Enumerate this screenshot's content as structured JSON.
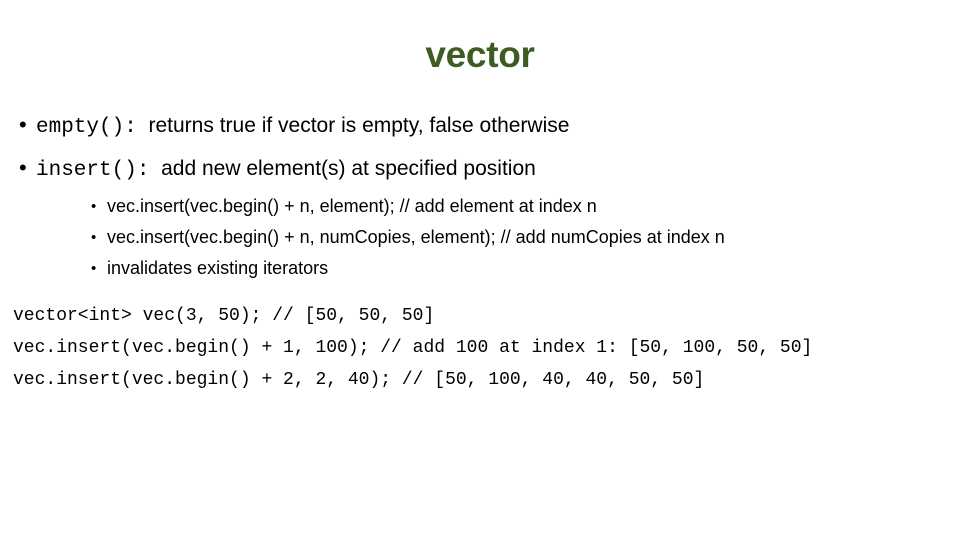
{
  "slide": {
    "title": "vector",
    "title_color": "#3d5c22",
    "background_color": "#ffffff",
    "text_color": "#000000"
  },
  "bullets": [
    {
      "code": "empty():",
      "description": "returns true if vector is empty, false otherwise",
      "bullet_glyph": "•"
    },
    {
      "code": "insert():",
      "description": "add new element(s) at specified position",
      "bullet_glyph": "•"
    }
  ],
  "sub_bullets": [
    {
      "text": "vec.insert(vec.begin() + n, element); // add element at index n",
      "bullet_glyph": "•"
    },
    {
      "text": "vec.insert(vec.begin() + n, numCopies, element); // add numCopies at index n",
      "bullet_glyph": "•"
    },
    {
      "text": "invalidates existing iterators",
      "bullet_glyph": "•"
    }
  ],
  "code_block": {
    "lines": [
      "vector<int> vec(3, 50); // [50, 50, 50]",
      "vec.insert(vec.begin() + 1, 100); // add 100 at index 1: [50, 100, 50, 50]",
      "vec.insert(vec.begin() + 2, 2, 40); // [50, 100, 40, 40, 50, 50]"
    ]
  }
}
